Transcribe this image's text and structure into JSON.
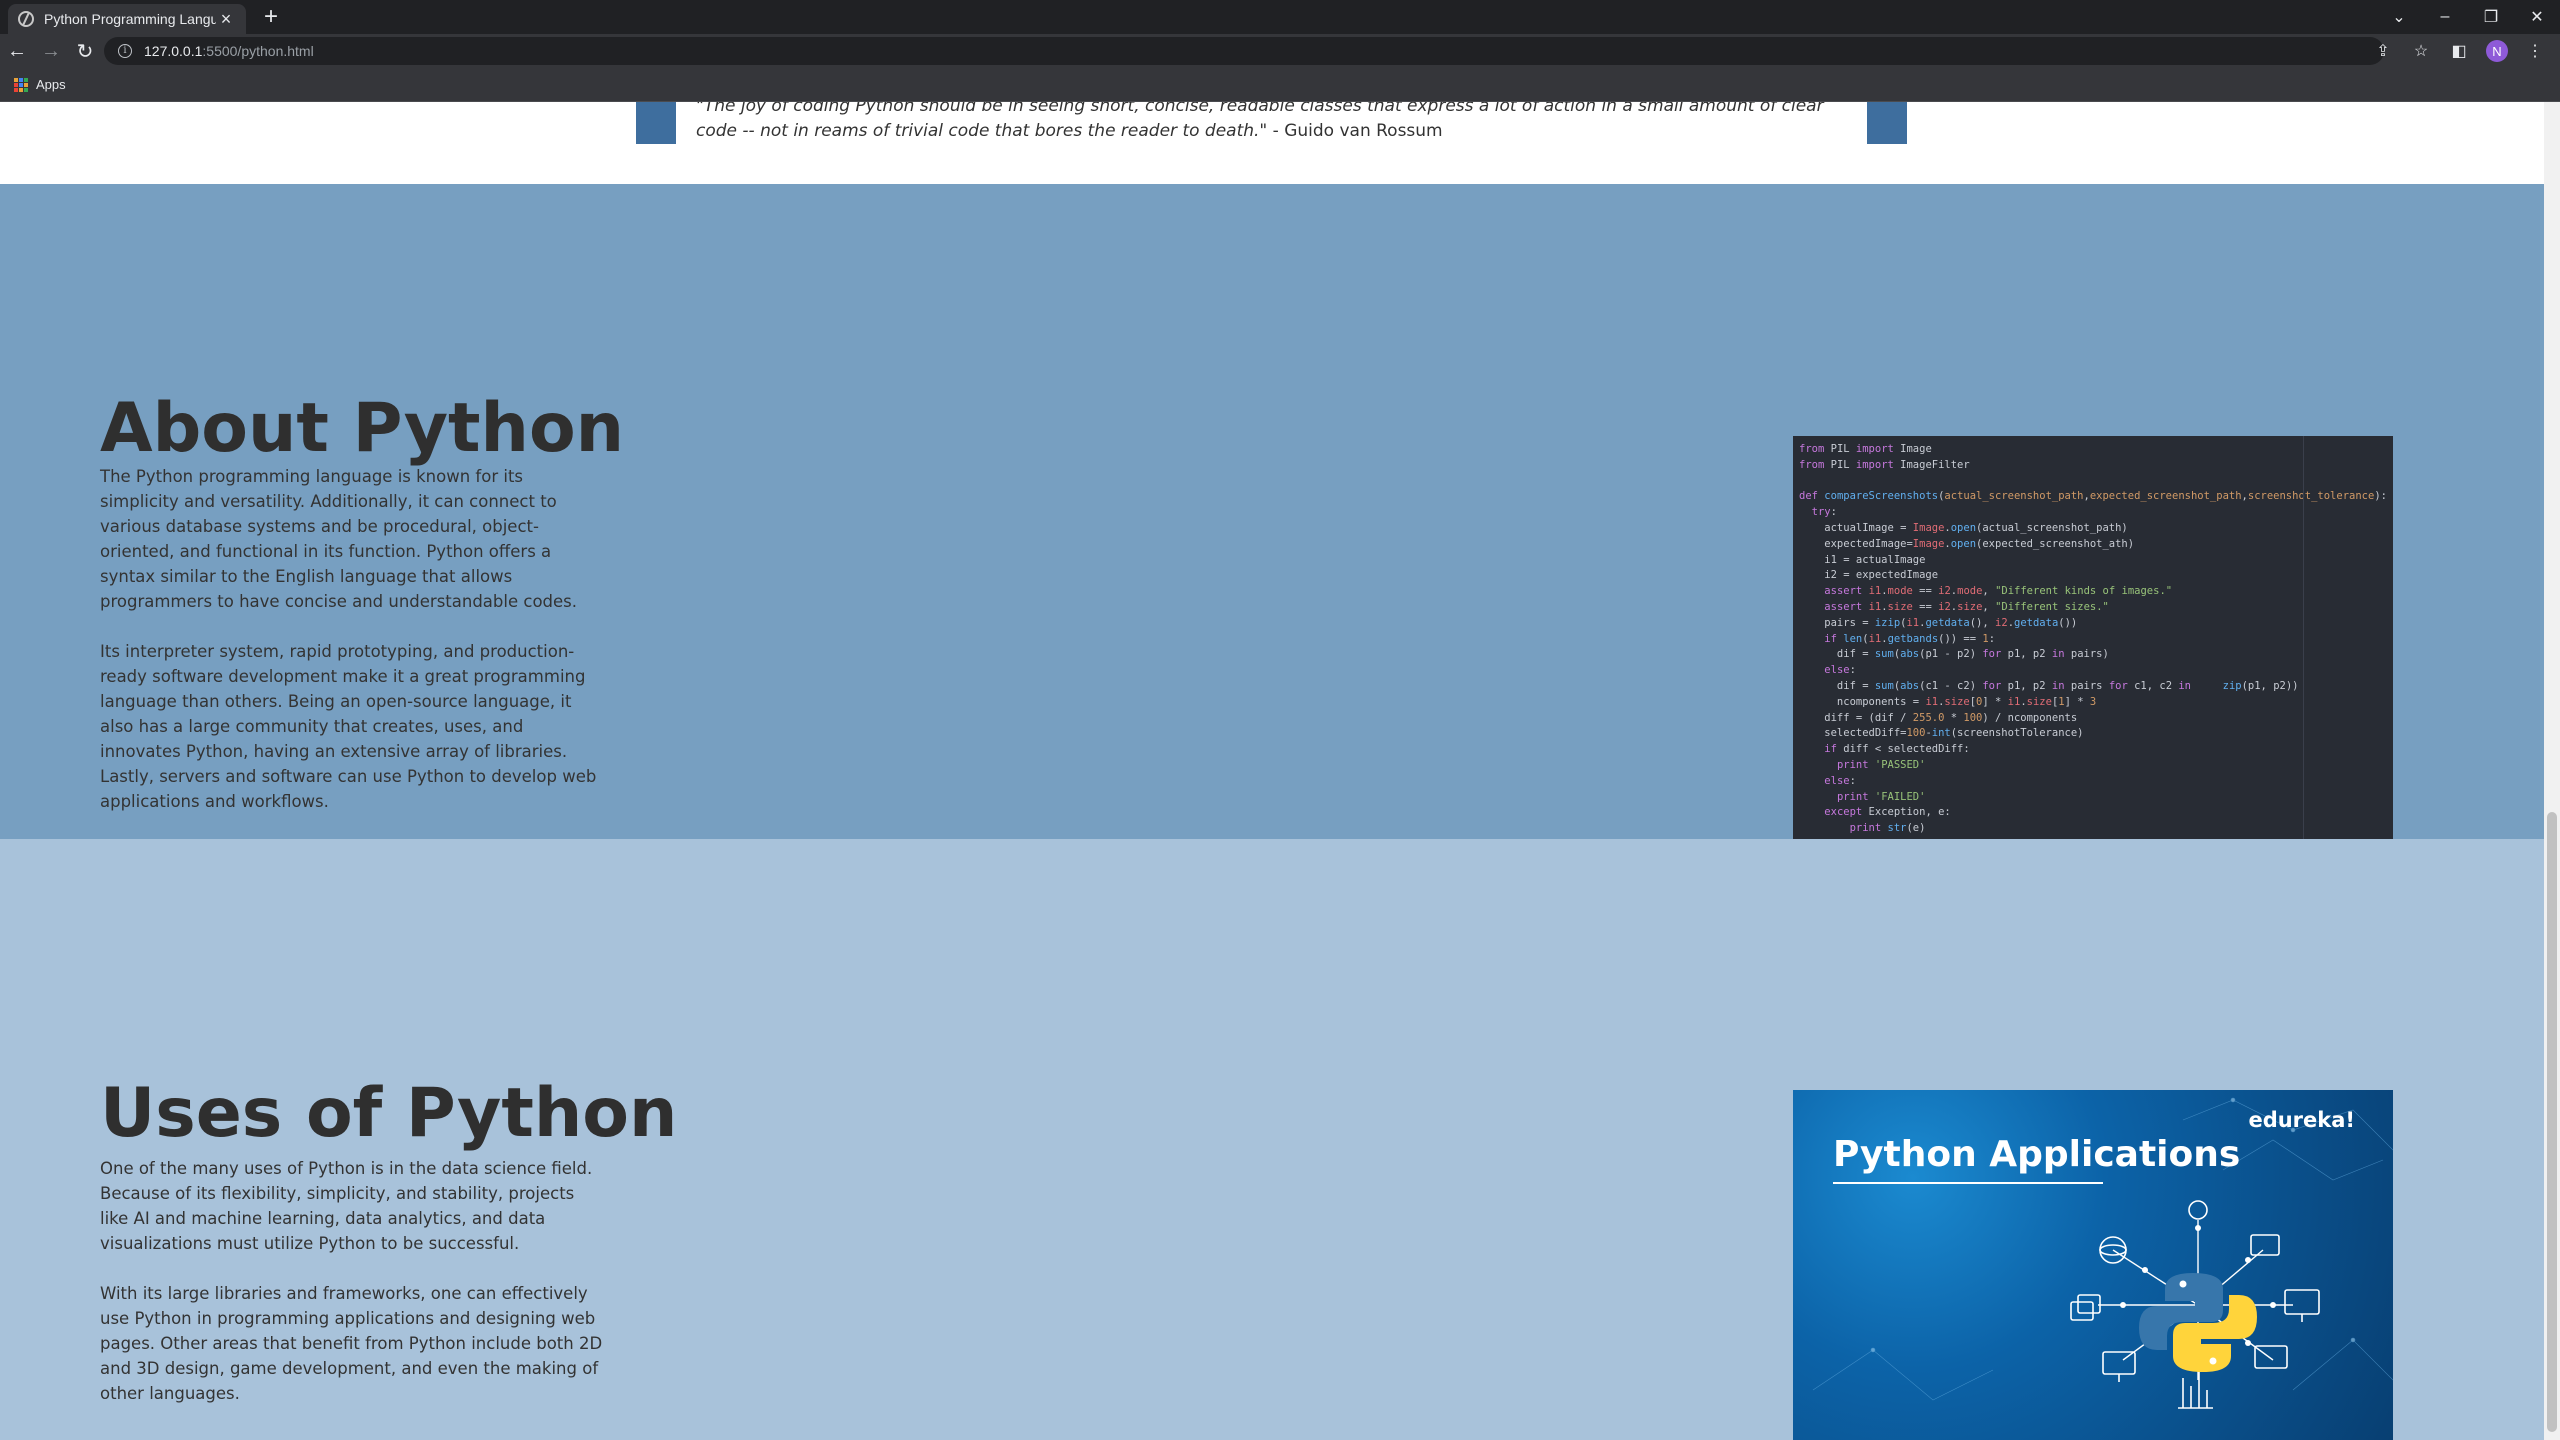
{
  "browser": {
    "tab_title": "Python Programming Language",
    "url_host": "127.0.0.1",
    "url_path": ":5500/python.html",
    "bookmarks_apps_label": "Apps",
    "profile_initial": "N"
  },
  "quote": {
    "text": "\"The joy of coding Python should be in seeing short, concise, readable classes that express a lot of action in a small amount of clear code -- not in reams of trivial code that bores the reader to death.\"",
    "author": "- Guido van Rossum"
  },
  "about": {
    "title": "About Python",
    "paragraph_1": "The Python programming language is known for its simplicity and versatility. Additionally, it can connect to various database systems and be procedural, object-oriented, and functional in its function. Python offers a syntax similar to the English language that allows programmers to have concise and understandable codes.",
    "paragraph_2": "Its interpreter system, rapid prototyping, and production-ready software development make it a great programming language than others. Being an open-source language, it also has a large community that creates, uses, and innovates Python, having an extensive array of libraries. Lastly, servers and software can use Python to develop web applications and workflows."
  },
  "uses": {
    "title": "Uses of Python",
    "paragraph_1": "One of the many uses of Python is in the data science field. Because of its flexibility, simplicity, and stability, projects like AI and machine learning, data analytics, and data visualizations must utilize Python to be successful.",
    "paragraph_2": "With its large libraries and frameworks, one can effectively use Python in programming applications and designing web pages. Other areas that benefit from Python include both 2D and 3D design, game development, and even the making of other languages."
  },
  "banner": {
    "brand": "edureka!",
    "title": "Python Applications"
  },
  "colors": {
    "about_bg": "#779fc1",
    "uses_bg": "#a8c2da",
    "quote_bar": "#3e6e9e"
  }
}
